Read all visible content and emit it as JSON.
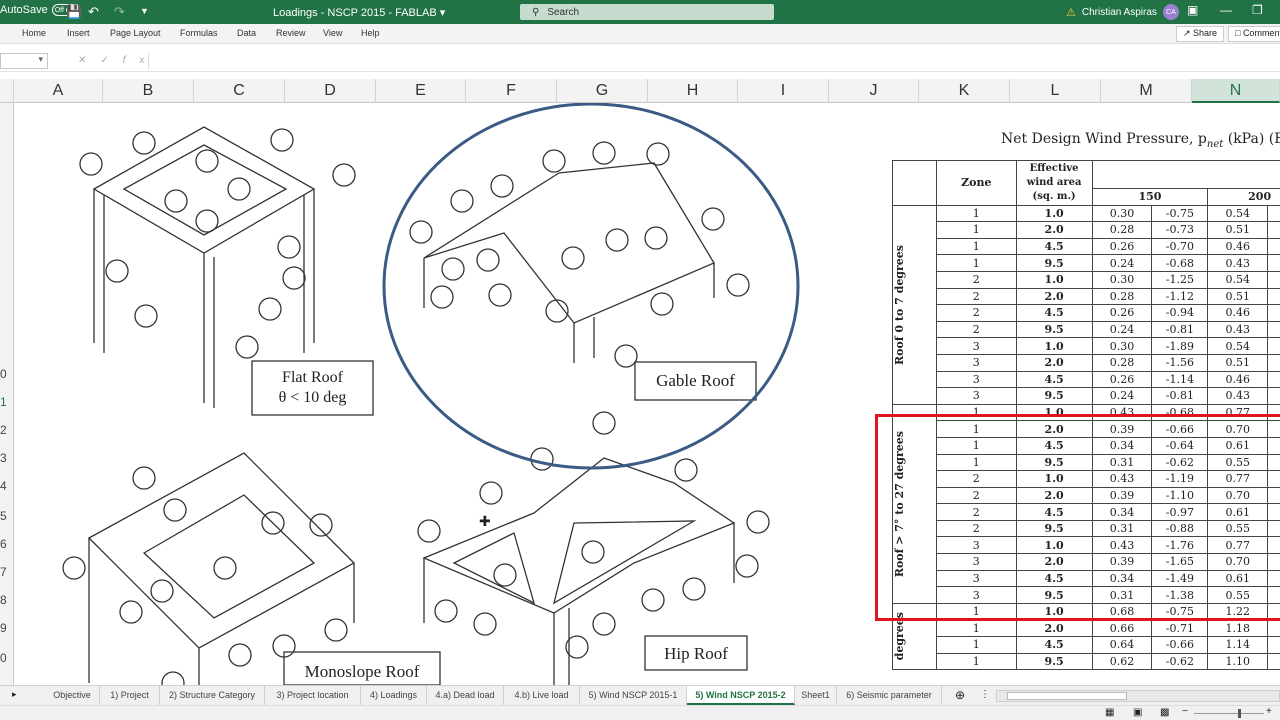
{
  "titlebar": {
    "autosave_label": "AutoSave",
    "autosave_state": "Off",
    "doc_title": "Loadings - NSCP 2015 - FABLAB",
    "search_placeholder": "Search",
    "user_name": "Christian Aspiras",
    "user_initials": "CA"
  },
  "ribbon": {
    "tabs": [
      "Home",
      "Insert",
      "Page Layout",
      "Formulas",
      "Data",
      "Review",
      "View",
      "Help"
    ],
    "share": "Share",
    "comments": "Comments"
  },
  "formula": {
    "fx": "fx"
  },
  "columns": [
    "A",
    "B",
    "C",
    "D",
    "E",
    "F",
    "G",
    "H",
    "I",
    "J",
    "K",
    "L",
    "M",
    "N"
  ],
  "rows_visible": [
    "0",
    "1",
    "2",
    "3",
    "4",
    "5",
    "6",
    "7",
    "8",
    "9",
    "0"
  ],
  "diagrams": {
    "flat": {
      "label_line1": "Flat Roof",
      "label_line2": "θ < 10 deg"
    },
    "gable": {
      "label": "Gable Roof"
    },
    "mono": {
      "label": "Monoslope Roof"
    },
    "hip": {
      "label": "Hip Roof"
    }
  },
  "table": {
    "title": "Net Design Wind Pressure, p",
    "title_sub": "net",
    "title_suffix": " (kPa) (Exp",
    "header_zone": "Zone",
    "header_area": "Effective wind area (sq. m.)",
    "header_150": "150",
    "header_200": "200",
    "group1_label": "Roof 0 to 7 degrees",
    "group2_label": "Roof > 7° to 27 degrees",
    "group3_label": "degrees",
    "group1_rows": [
      [
        "1",
        "1.0",
        "0.30",
        "-0.75",
        "0.54"
      ],
      [
        "1",
        "2.0",
        "0.28",
        "-0.73",
        "0.51"
      ],
      [
        "1",
        "4.5",
        "0.26",
        "-0.70",
        "0.46"
      ],
      [
        "1",
        "9.5",
        "0.24",
        "-0.68",
        "0.43"
      ],
      [
        "2",
        "1.0",
        "0.30",
        "-1.25",
        "0.54"
      ],
      [
        "2",
        "2.0",
        "0.28",
        "-1.12",
        "0.51"
      ],
      [
        "2",
        "4.5",
        "0.26",
        "-0.94",
        "0.46"
      ],
      [
        "2",
        "9.5",
        "0.24",
        "-0.81",
        "0.43"
      ],
      [
        "3",
        "1.0",
        "0.30",
        "-1.89",
        "0.54"
      ],
      [
        "3",
        "2.0",
        "0.28",
        "-1.56",
        "0.51"
      ],
      [
        "3",
        "4.5",
        "0.26",
        "-1.14",
        "0.46"
      ],
      [
        "3",
        "9.5",
        "0.24",
        "-0.81",
        "0.43"
      ]
    ],
    "group2_rows": [
      [
        "1",
        "1.0",
        "0.43",
        "-0.68",
        "0.77"
      ],
      [
        "1",
        "2.0",
        "0.39",
        "-0.66",
        "0.70"
      ],
      [
        "1",
        "4.5",
        "0.34",
        "-0.64",
        "0.61"
      ],
      [
        "1",
        "9.5",
        "0.31",
        "-0.62",
        "0.55"
      ],
      [
        "2",
        "1.0",
        "0.43",
        "-1.19",
        "0.77"
      ],
      [
        "2",
        "2.0",
        "0.39",
        "-1.10",
        "0.70"
      ],
      [
        "2",
        "4.5",
        "0.34",
        "-0.97",
        "0.61"
      ],
      [
        "2",
        "9.5",
        "0.31",
        "-0.88",
        "0.55"
      ],
      [
        "3",
        "1.0",
        "0.43",
        "-1.76",
        "0.77"
      ],
      [
        "3",
        "2.0",
        "0.39",
        "-1.65",
        "0.70"
      ],
      [
        "3",
        "4.5",
        "0.34",
        "-1.49",
        "0.61"
      ],
      [
        "3",
        "9.5",
        "0.31",
        "-1.38",
        "0.55"
      ]
    ],
    "group3_rows": [
      [
        "1",
        "1.0",
        "0.68",
        "-0.75",
        "1.22"
      ],
      [
        "1",
        "2.0",
        "0.66",
        "-0.71",
        "1.18"
      ],
      [
        "1",
        "4.5",
        "0.64",
        "-0.66",
        "1.14"
      ],
      [
        "1",
        "9.5",
        "0.62",
        "-0.62",
        "1.10"
      ]
    ]
  },
  "sheet_tabs": [
    "Objective",
    "1) Project",
    "2) Structure Category",
    "3) Project location",
    "4) Loadings",
    "4.a) Dead load",
    "4.b) Live load",
    "5) Wind NSCP 2015-1",
    "5) Wind NSCP 2015-2",
    "Sheet1",
    "6) Seismic parameter"
  ],
  "active_sheet": "5) Wind NSCP 2015-2",
  "colors": {
    "excel_green": "#217346",
    "highlight_red": "#e0141e",
    "circle_blue": "#3b5a85"
  }
}
